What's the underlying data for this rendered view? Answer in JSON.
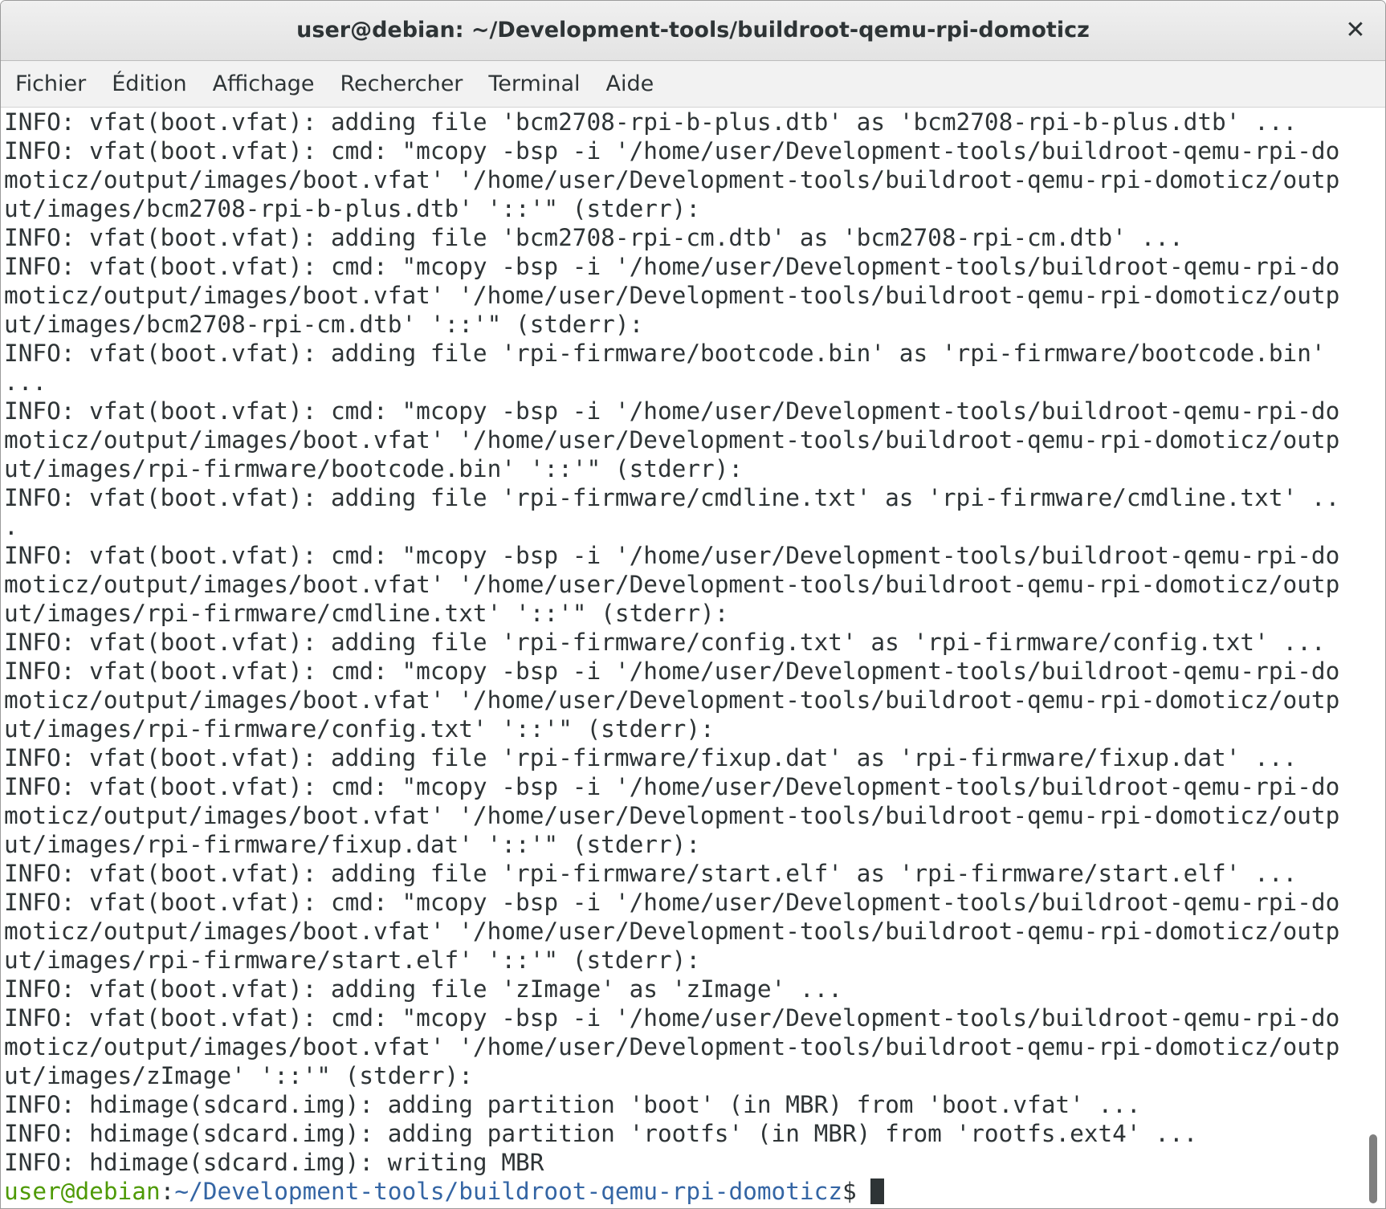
{
  "window": {
    "title": "user@debian: ~/Development-tools/buildroot-qemu-rpi-domoticz",
    "close_icon": "close-icon",
    "close_glyph": "✕"
  },
  "menubar": {
    "items": [
      {
        "label": "Fichier"
      },
      {
        "label": "Édition"
      },
      {
        "label": "Affichage"
      },
      {
        "label": "Rechercher"
      },
      {
        "label": "Terminal"
      },
      {
        "label": "Aide"
      }
    ]
  },
  "terminal": {
    "lines": [
      "INFO: vfat(boot.vfat): adding file 'bcm2708-rpi-b-plus.dtb' as 'bcm2708-rpi-b-plus.dtb' ...",
      "INFO: vfat(boot.vfat): cmd: \"mcopy -bsp -i '/home/user/Development-tools/buildroot-qemu-rpi-do",
      "moticz/output/images/boot.vfat' '/home/user/Development-tools/buildroot-qemu-rpi-domoticz/outp",
      "ut/images/bcm2708-rpi-b-plus.dtb' '::'\" (stderr):",
      "INFO: vfat(boot.vfat): adding file 'bcm2708-rpi-cm.dtb' as 'bcm2708-rpi-cm.dtb' ...",
      "INFO: vfat(boot.vfat): cmd: \"mcopy -bsp -i '/home/user/Development-tools/buildroot-qemu-rpi-do",
      "moticz/output/images/boot.vfat' '/home/user/Development-tools/buildroot-qemu-rpi-domoticz/outp",
      "ut/images/bcm2708-rpi-cm.dtb' '::'\" (stderr):",
      "INFO: vfat(boot.vfat): adding file 'rpi-firmware/bootcode.bin' as 'rpi-firmware/bootcode.bin'",
      "...",
      "INFO: vfat(boot.vfat): cmd: \"mcopy -bsp -i '/home/user/Development-tools/buildroot-qemu-rpi-do",
      "moticz/output/images/boot.vfat' '/home/user/Development-tools/buildroot-qemu-rpi-domoticz/outp",
      "ut/images/rpi-firmware/bootcode.bin' '::'\" (stderr):",
      "INFO: vfat(boot.vfat): adding file 'rpi-firmware/cmdline.txt' as 'rpi-firmware/cmdline.txt' ..",
      ".",
      "INFO: vfat(boot.vfat): cmd: \"mcopy -bsp -i '/home/user/Development-tools/buildroot-qemu-rpi-do",
      "moticz/output/images/boot.vfat' '/home/user/Development-tools/buildroot-qemu-rpi-domoticz/outp",
      "ut/images/rpi-firmware/cmdline.txt' '::'\" (stderr):",
      "INFO: vfat(boot.vfat): adding file 'rpi-firmware/config.txt' as 'rpi-firmware/config.txt' ...",
      "INFO: vfat(boot.vfat): cmd: \"mcopy -bsp -i '/home/user/Development-tools/buildroot-qemu-rpi-do",
      "moticz/output/images/boot.vfat' '/home/user/Development-tools/buildroot-qemu-rpi-domoticz/outp",
      "ut/images/rpi-firmware/config.txt' '::'\" (stderr):",
      "INFO: vfat(boot.vfat): adding file 'rpi-firmware/fixup.dat' as 'rpi-firmware/fixup.dat' ...",
      "INFO: vfat(boot.vfat): cmd: \"mcopy -bsp -i '/home/user/Development-tools/buildroot-qemu-rpi-do",
      "moticz/output/images/boot.vfat' '/home/user/Development-tools/buildroot-qemu-rpi-domoticz/outp",
      "ut/images/rpi-firmware/fixup.dat' '::'\" (stderr):",
      "INFO: vfat(boot.vfat): adding file 'rpi-firmware/start.elf' as 'rpi-firmware/start.elf' ...",
      "INFO: vfat(boot.vfat): cmd: \"mcopy -bsp -i '/home/user/Development-tools/buildroot-qemu-rpi-do",
      "moticz/output/images/boot.vfat' '/home/user/Development-tools/buildroot-qemu-rpi-domoticz/outp",
      "ut/images/rpi-firmware/start.elf' '::'\" (stderr):",
      "INFO: vfat(boot.vfat): adding file 'zImage' as 'zImage' ...",
      "INFO: vfat(boot.vfat): cmd: \"mcopy -bsp -i '/home/user/Development-tools/buildroot-qemu-rpi-do",
      "moticz/output/images/boot.vfat' '/home/user/Development-tools/buildroot-qemu-rpi-domoticz/outp",
      "ut/images/zImage' '::'\" (stderr):",
      "INFO: hdimage(sdcard.img): adding partition 'boot' (in MBR) from 'boot.vfat' ...",
      "INFO: hdimage(sdcard.img): adding partition 'rootfs' (in MBR) from 'rootfs.ext4' ...",
      "INFO: hdimage(sdcard.img): writing MBR"
    ],
    "prompt": {
      "user_host": "user@debian",
      "separator": ":",
      "path": "~/Development-tools/buildroot-qemu-rpi-domoticz",
      "symbol": "$ "
    }
  },
  "colors": {
    "text": "#2e3436",
    "prompt_user": "#4e9a06",
    "prompt_path": "#3465a4",
    "background": "#ffffff"
  }
}
